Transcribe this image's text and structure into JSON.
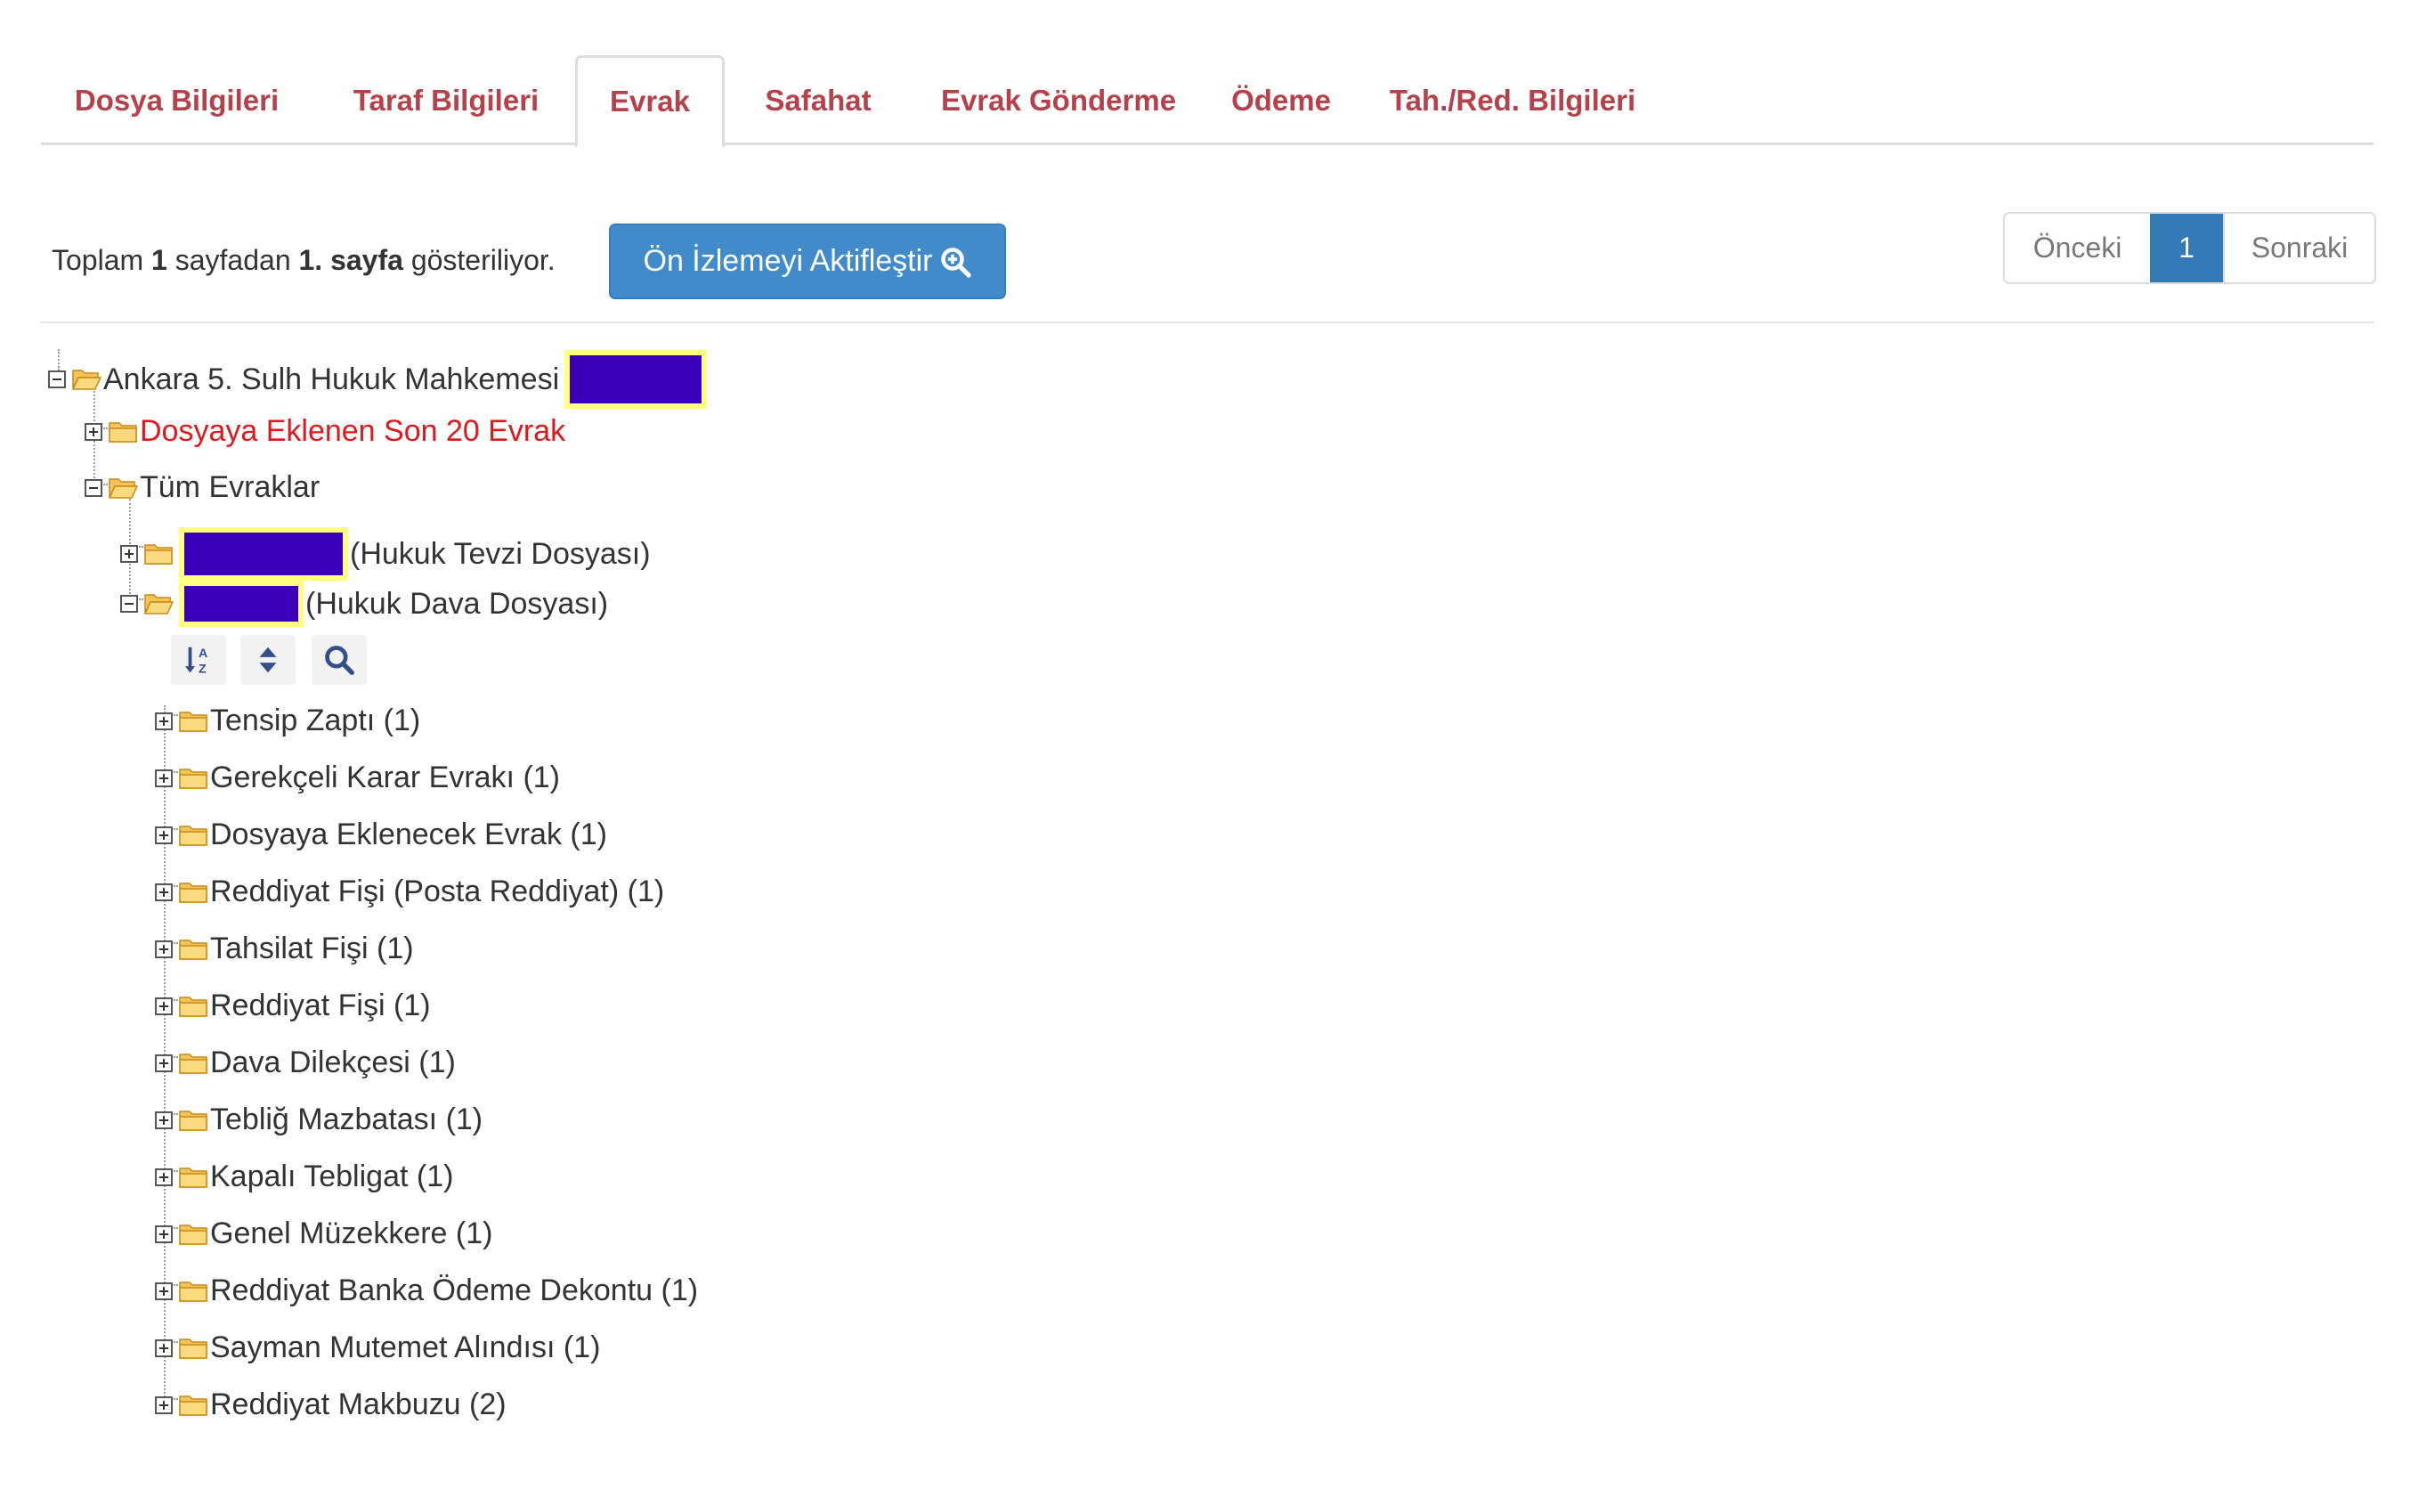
{
  "tabs": [
    {
      "label": "Dosya Bilgileri"
    },
    {
      "label": "Taraf Bilgileri"
    },
    {
      "label": "Evrak"
    },
    {
      "label": "Safahat"
    },
    {
      "label": "Evrak Gönderme"
    },
    {
      "label": "Ödeme"
    },
    {
      "label": "Tah./Red. Bilgileri"
    }
  ],
  "active_tab": "Evrak",
  "summary": {
    "prefix": "Toplam ",
    "total": "1",
    "middle": " sayfadan ",
    "current": "1. sayfa",
    "suffix": " gösteriliyor."
  },
  "preview_button": {
    "label": "Ön İzlemeyi Aktifleştir",
    "icon": "zoom-in-icon"
  },
  "pagination": {
    "prev": "Önceki",
    "current": "1",
    "next": "Sonraki"
  },
  "tree": {
    "root": {
      "label": "Ankara 5. Sulh Hukuk Mahkemesi"
    },
    "recent": {
      "label": "Dosyaya Eklenen Son 20 Evrak"
    },
    "all": {
      "label": "Tüm Evraklar"
    },
    "tevzi": {
      "label": "(Hukuk Tevzi Dosyası)"
    },
    "dava": {
      "label": "(Hukuk Dava Dosyası)"
    },
    "tools": [
      "sort-alpha-icon",
      "sort-icon",
      "search-icon"
    ],
    "documents": [
      "Tensip Zaptı (1)",
      "Gerekçeli Karar Evrakı (1)",
      "Dosyaya Eklenecek Evrak (1)",
      "Reddiyat Fişi (Posta Reddiyat) (1)",
      "Tahsilat Fişi (1)",
      "Reddiyat Fişi (1)",
      "Dava Dilekçesi (1)",
      "Tebliğ Mazbatası (1)",
      "Kapalı Tebligat (1)",
      "Genel Müzekkere (1)",
      "Reddiyat Banka Ödeme Dekontu (1)",
      "Sayman Mutemet Alındısı (1)",
      "Reddiyat Makbuzu (2)"
    ]
  },
  "colors": {
    "tab_text": "#b5414b",
    "primary": "#428bca",
    "pager_active": "#337ab7",
    "recent_label": "#e3161b",
    "redaction": "#3b00b8",
    "redaction_border": "#ffff80",
    "folder": "#f5c35a"
  }
}
